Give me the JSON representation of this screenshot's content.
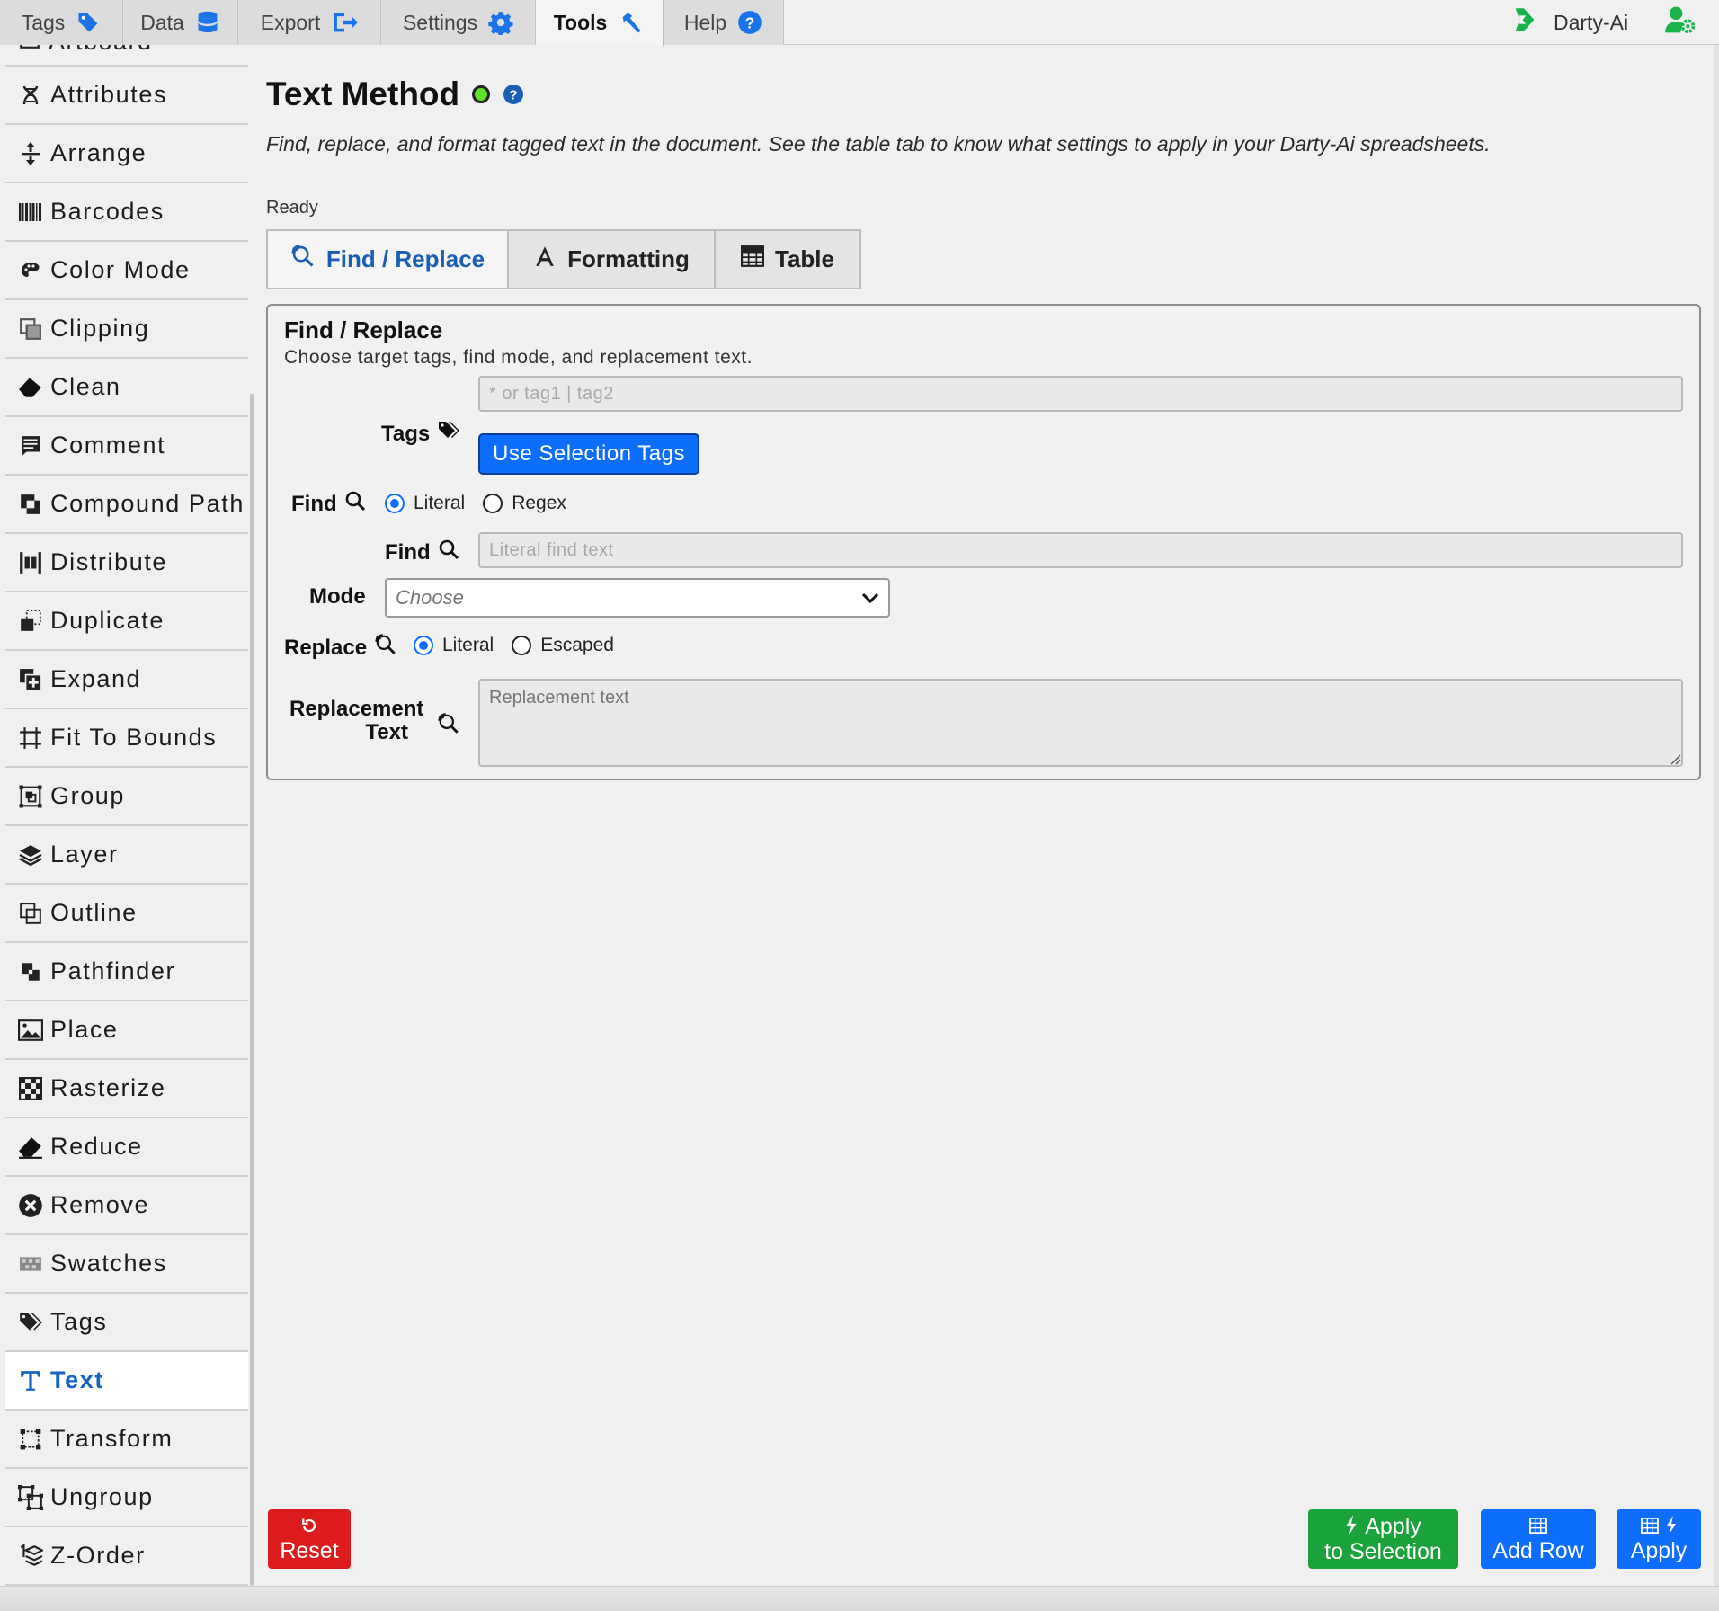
{
  "top_tabs": [
    {
      "label": "Tags",
      "icon": "tag-icon"
    },
    {
      "label": "Data",
      "icon": "database-icon"
    },
    {
      "label": "Export",
      "icon": "export-icon"
    },
    {
      "label": "Settings",
      "icon": "gear-icon"
    },
    {
      "label": "Tools",
      "icon": "hammer-icon",
      "active": true
    },
    {
      "label": "Help",
      "icon": "help-icon"
    }
  ],
  "brand": {
    "name": "Darty-Ai"
  },
  "sidebar": {
    "partial_item": "Artboard",
    "items": [
      {
        "label": "Attributes",
        "icon": "dna-icon"
      },
      {
        "label": "Arrange",
        "icon": "arrange-icon"
      },
      {
        "label": "Barcodes",
        "icon": "barcode-icon"
      },
      {
        "label": "Color Mode",
        "icon": "palette-icon"
      },
      {
        "label": "Clipping",
        "icon": "clipping-icon"
      },
      {
        "label": "Clean",
        "icon": "eraser-icon"
      },
      {
        "label": "Comment",
        "icon": "comment-icon"
      },
      {
        "label": "Compound Path",
        "icon": "compound-path-icon"
      },
      {
        "label": "Distribute",
        "icon": "distribute-icon"
      },
      {
        "label": "Duplicate",
        "icon": "duplicate-icon"
      },
      {
        "label": "Expand",
        "icon": "expand-icon"
      },
      {
        "label": "Fit To Bounds",
        "icon": "fit-bounds-icon"
      },
      {
        "label": "Group",
        "icon": "group-icon"
      },
      {
        "label": "Layer",
        "icon": "layers-icon"
      },
      {
        "label": "Outline",
        "icon": "outline-icon"
      },
      {
        "label": "Pathfinder",
        "icon": "pathfinder-icon"
      },
      {
        "label": "Place",
        "icon": "image-icon"
      },
      {
        "label": "Rasterize",
        "icon": "checkerboard-icon"
      },
      {
        "label": "Reduce",
        "icon": "eraser-icon"
      },
      {
        "label": "Remove",
        "icon": "remove-icon"
      },
      {
        "label": "Swatches",
        "icon": "swatches-icon"
      },
      {
        "label": "Tags",
        "icon": "tags-icon"
      },
      {
        "label": "Text",
        "icon": "text-icon",
        "active": true
      },
      {
        "label": "Transform",
        "icon": "transform-icon"
      },
      {
        "label": "Ungroup",
        "icon": "ungroup-icon"
      },
      {
        "label": "Z-Order",
        "icon": "z-order-icon"
      }
    ]
  },
  "main": {
    "title": "Text Method",
    "status_color": "#5ee326",
    "description": "Find, replace, and format tagged text in the document. See the table tab to know what settings to apply in your Darty-Ai spreadsheets.",
    "status": "Ready",
    "tabs": [
      {
        "label": "Find / Replace",
        "icon": "find-replace-icon",
        "active": true
      },
      {
        "label": "Formatting",
        "icon": "font-icon"
      },
      {
        "label": "Table",
        "icon": "table-icon"
      }
    ]
  },
  "panel": {
    "title": "Find / Replace",
    "subtitle": "Choose target tags, find mode, and replacement text.",
    "tags_label": "Tags",
    "tags_placeholder": "* or tag1 | tag2",
    "use_selection_tags": "Use Selection Tags",
    "find_mode_label": "Find",
    "find_modes": [
      "Literal",
      "Regex"
    ],
    "find_label": "Find",
    "find_placeholder": "Literal find text",
    "mode_label": "Mode",
    "mode_value": "Choose",
    "replace_mode_label": "Replace",
    "replace_modes": [
      "Literal",
      "Escaped"
    ],
    "replacement_label_1": "Replacement",
    "replacement_label_2": "Text",
    "replacement_placeholder": "Replacement text"
  },
  "actions": {
    "reset": "Reset",
    "apply_selection_1": "Apply",
    "apply_selection_2": "to Selection",
    "add_row": "Add Row",
    "apply": "Apply",
    "colors": {
      "reset": "#dc1c1c",
      "apply_selection": "#1aa33a",
      "add_row": "#0d6efd",
      "apply": "#0d6efd"
    }
  }
}
